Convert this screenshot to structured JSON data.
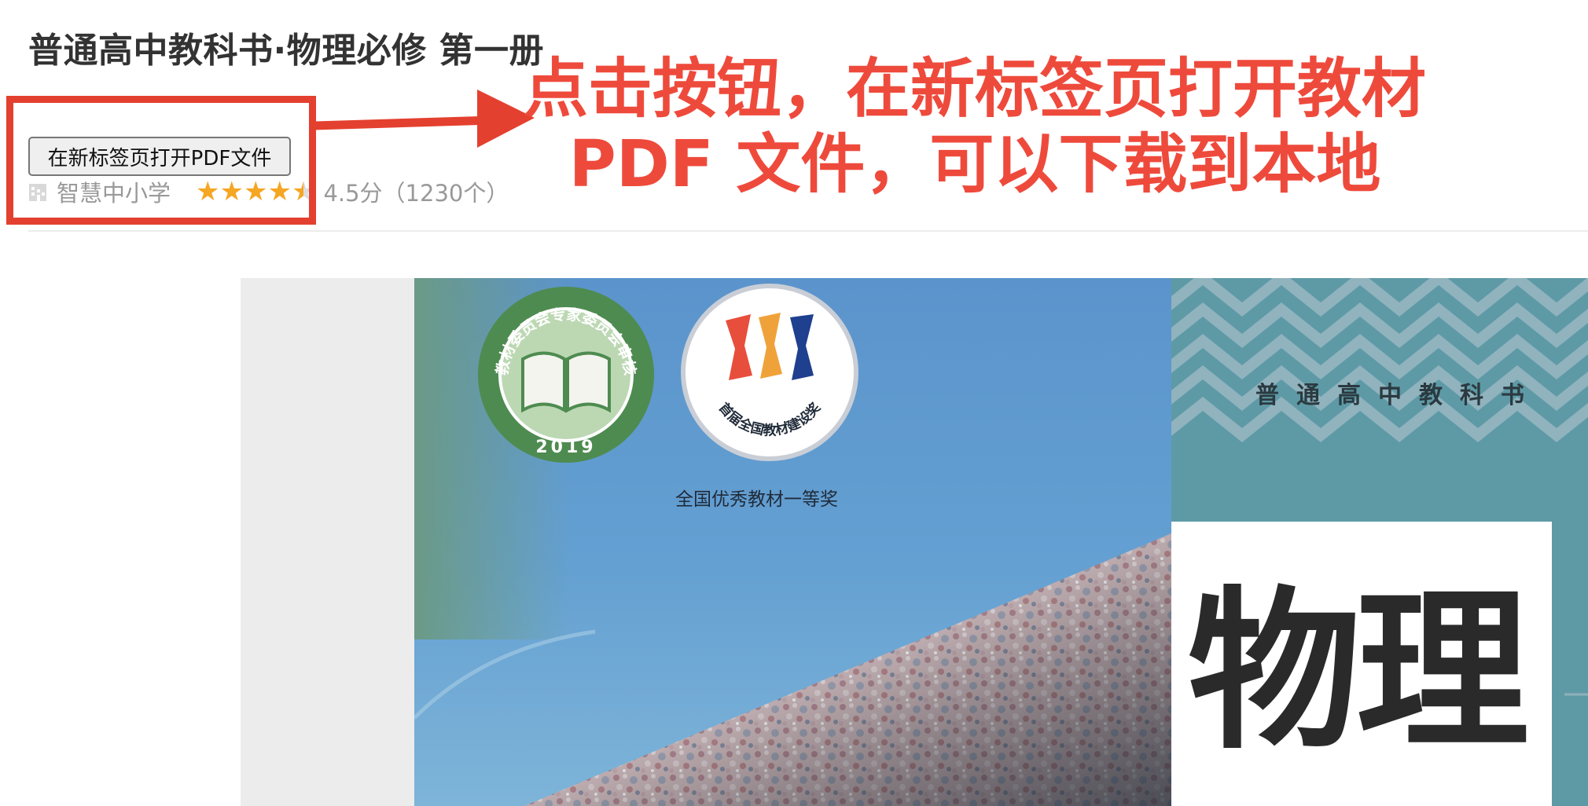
{
  "page": {
    "title": "普通高中教科书·物理必修 第一册"
  },
  "toolbar": {
    "open_pdf_label": "在新标签页打开PDF文件"
  },
  "meta": {
    "publisher": "智慧中小学",
    "rating": 4.5,
    "rating_text": "4.5分（1230个）",
    "star_icon": "star-icon",
    "publisher_icon": "building-icon"
  },
  "annotation": {
    "line1": "点击按钮，在新标签页打开教材",
    "line2": "PDF 文件，可以下载到本地",
    "color": "#ee4a3c"
  },
  "cover": {
    "series": "普通高中教科书",
    "subject": "物理",
    "award_caption": "全国优秀教材一等奖",
    "seal_left_text": "国家教材委员会专家委员会审核通过",
    "seal_left_year": "2019",
    "seal_right_text": "首届全国教材建设奖"
  },
  "colors": {
    "accent_red": "#e4402f",
    "star": "#f5a623",
    "muted_text": "#999999",
    "sky": "#5b94cc",
    "teal": "#5e9aa6"
  }
}
